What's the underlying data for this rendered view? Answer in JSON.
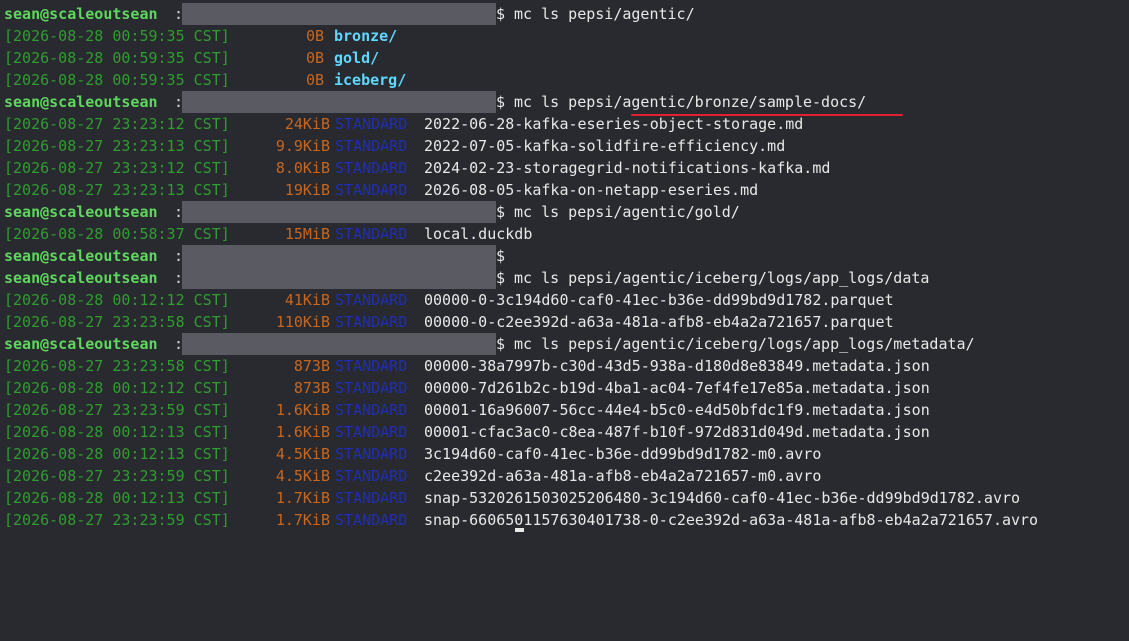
{
  "prompt": {
    "user": "sean@scaleoutsean",
    "colon": ":",
    "dollar": "$"
  },
  "commands": [
    "mc ls pepsi/agentic/",
    "mc ls pepsi/agentic/bronze/sample-docs/",
    "mc ls pepsi/agentic/gold/",
    "",
    "mc ls pepsi/agentic/iceberg/logs/app_logs/data",
    "mc ls pepsi/agentic/iceberg/logs/app_logs/metadata/"
  ],
  "dir_entries": [
    {
      "ts": "[2026-08-28 00:59:35 CST]",
      "size": "0B",
      "name": "bronze/"
    },
    {
      "ts": "[2026-08-28 00:59:35 CST]",
      "size": "0B",
      "name": "gold/"
    },
    {
      "ts": "[2026-08-28 00:59:35 CST]",
      "size": "0B",
      "name": "iceberg/"
    }
  ],
  "sample_docs": [
    {
      "ts": "[2026-08-27 23:23:12 CST]",
      "size": "24KiB",
      "class": "STANDARD",
      "name": "2022-06-28-kafka-eseries-object-storage.md"
    },
    {
      "ts": "[2026-08-27 23:23:13 CST]",
      "size": "9.9KiB",
      "class": "STANDARD",
      "name": "2022-07-05-kafka-solidfire-efficiency.md"
    },
    {
      "ts": "[2026-08-27 23:23:12 CST]",
      "size": "8.0KiB",
      "class": "STANDARD",
      "name": "2024-02-23-storagegrid-notifications-kafka.md"
    },
    {
      "ts": "[2026-08-27 23:23:13 CST]",
      "size": "19KiB",
      "class": "STANDARD",
      "name": "2026-08-05-kafka-on-netapp-eseries.md"
    }
  ],
  "gold": [
    {
      "ts": "[2026-08-28 00:58:37 CST]",
      "size": "15MiB",
      "class": "STANDARD",
      "name": "local.duckdb"
    }
  ],
  "data_files": [
    {
      "ts": "[2026-08-28 00:12:12 CST]",
      "size": "41KiB",
      "class": "STANDARD",
      "name": "00000-0-3c194d60-caf0-41ec-b36e-dd99bd9d1782.parquet"
    },
    {
      "ts": "[2026-08-27 23:23:58 CST]",
      "size": "110KiB",
      "class": "STANDARD",
      "name": "00000-0-c2ee392d-a63a-481a-afb8-eb4a2a721657.parquet"
    }
  ],
  "metadata_files": [
    {
      "ts": "[2026-08-27 23:23:58 CST]",
      "size": "873B",
      "class": "STANDARD",
      "name": "00000-38a7997b-c30d-43d5-938a-d180d8e83849.metadata.json"
    },
    {
      "ts": "[2026-08-28 00:12:12 CST]",
      "size": "873B",
      "class": "STANDARD",
      "name": "00000-7d261b2c-b19d-4ba1-ac04-7ef4fe17e85a.metadata.json"
    },
    {
      "ts": "[2026-08-27 23:23:59 CST]",
      "size": "1.6KiB",
      "class": "STANDARD",
      "name": "00001-16a96007-56cc-44e4-b5c0-e4d50bfdc1f9.metadata.json"
    },
    {
      "ts": "[2026-08-28 00:12:13 CST]",
      "size": "1.6KiB",
      "class": "STANDARD",
      "name": "00001-cfac3ac0-c8ea-487f-b10f-972d831d049d.metadata.json"
    },
    {
      "ts": "[2026-08-28 00:12:13 CST]",
      "size": "4.5KiB",
      "class": "STANDARD",
      "name": "3c194d60-caf0-41ec-b36e-dd99bd9d1782-m0.avro"
    },
    {
      "ts": "[2026-08-27 23:23:59 CST]",
      "size": "4.5KiB",
      "class": "STANDARD",
      "name": "c2ee392d-a63a-481a-afb8-eb4a2a721657-m0.avro"
    },
    {
      "ts": "[2026-08-28 00:12:13 CST]",
      "size": "1.7KiB",
      "class": "STANDARD",
      "name": "snap-5320261503025206480-3c194d60-caf0-41ec-b36e-dd99bd9d1782.avro"
    },
    {
      "ts": "[2026-08-27 23:23:59 CST]",
      "size": "1.7KiB",
      "class": "STANDARD",
      "name": "snap-6606501157630401738-0-c2ee392d-a63a-481a-afb8-eb4a2a721657.avro"
    }
  ]
}
